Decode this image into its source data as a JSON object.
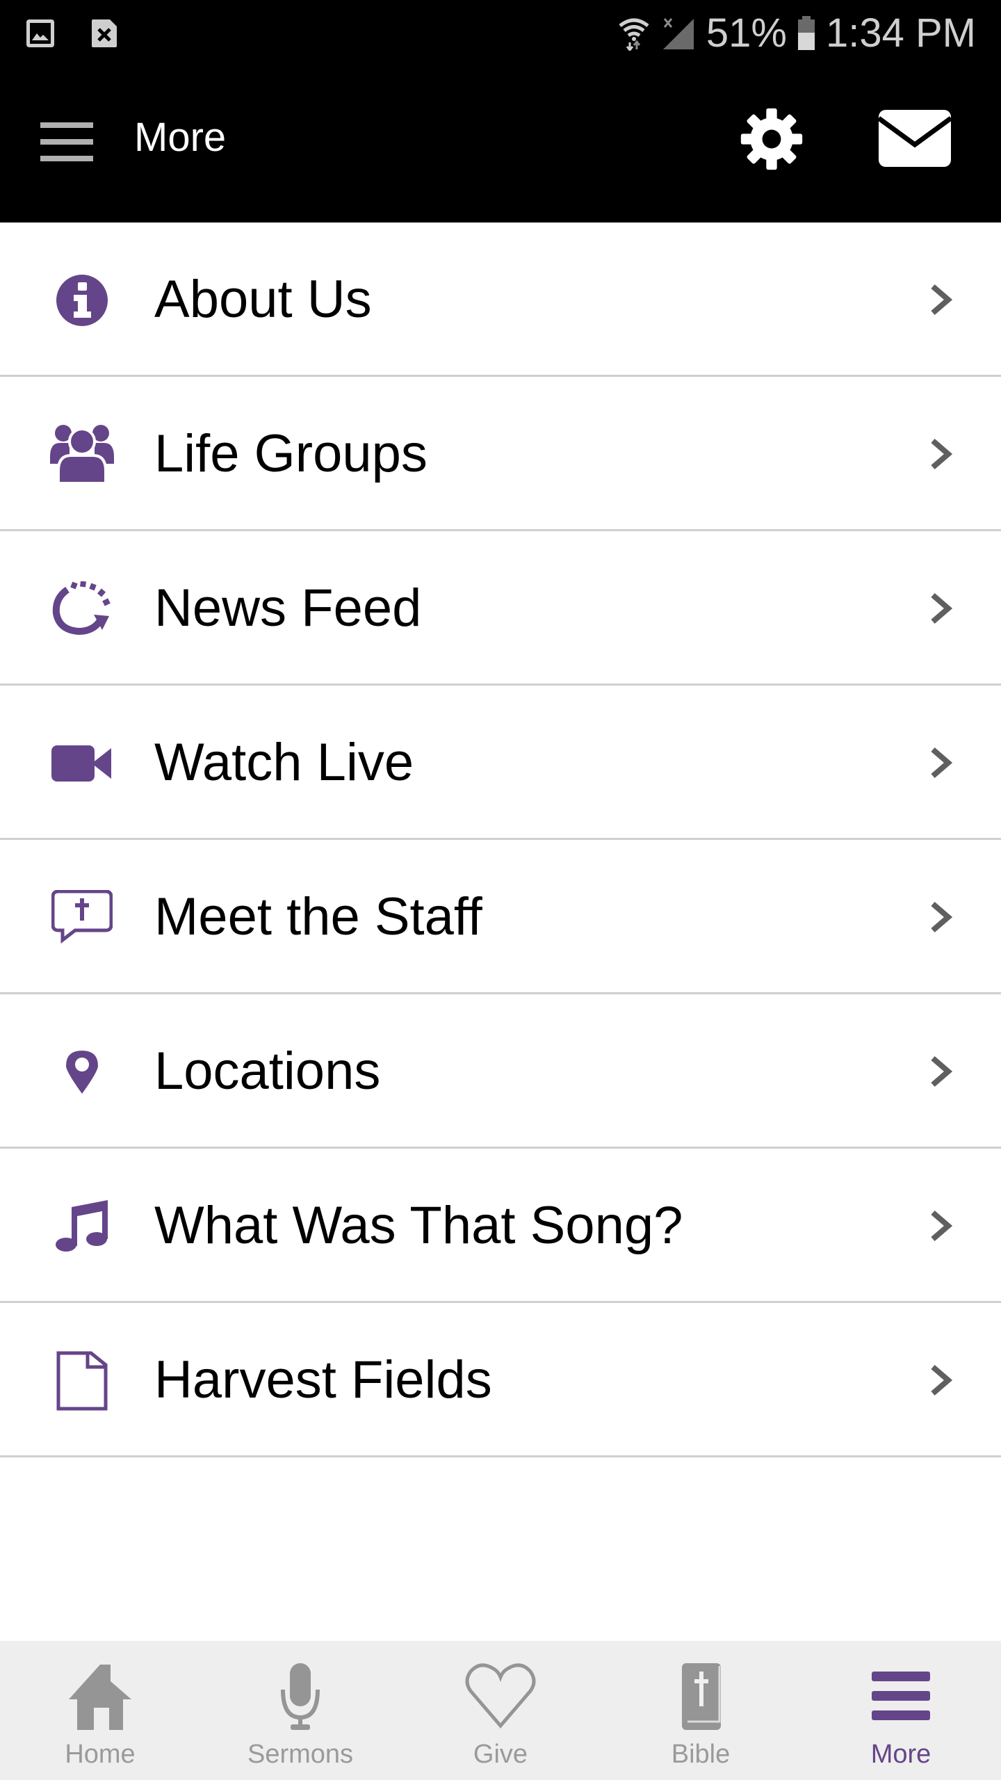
{
  "status_bar": {
    "battery": "51%",
    "time": "1:34 PM",
    "icons": [
      "gallery-notification-icon",
      "sim-error-icon",
      "wifi-icon",
      "signal-icon",
      "battery-icon"
    ]
  },
  "app_bar": {
    "title": "More",
    "icons": [
      "menu-icon",
      "gear-icon",
      "mail-icon"
    ]
  },
  "accent_color": "#654589",
  "menu_items": [
    {
      "label": "About Us",
      "icon": "info-icon"
    },
    {
      "label": "Life Groups",
      "icon": "users-icon"
    },
    {
      "label": "News Feed",
      "icon": "refresh-icon"
    },
    {
      "label": "Watch Live",
      "icon": "video-camera-icon"
    },
    {
      "label": "Meet the Staff",
      "icon": "chat-cross-icon"
    },
    {
      "label": "Locations",
      "icon": "map-pin-icon"
    },
    {
      "label": "What Was That Song?",
      "icon": "music-note-icon"
    },
    {
      "label": "Harvest Fields",
      "icon": "document-icon"
    }
  ],
  "bottom_nav": [
    {
      "label": "Home",
      "icon": "home-icon",
      "active": false
    },
    {
      "label": "Sermons",
      "icon": "microphone-icon",
      "active": false
    },
    {
      "label": "Give",
      "icon": "heart-icon",
      "active": false
    },
    {
      "label": "Bible",
      "icon": "bible-icon",
      "active": false
    },
    {
      "label": "More",
      "icon": "hamburger-icon",
      "active": true
    }
  ]
}
